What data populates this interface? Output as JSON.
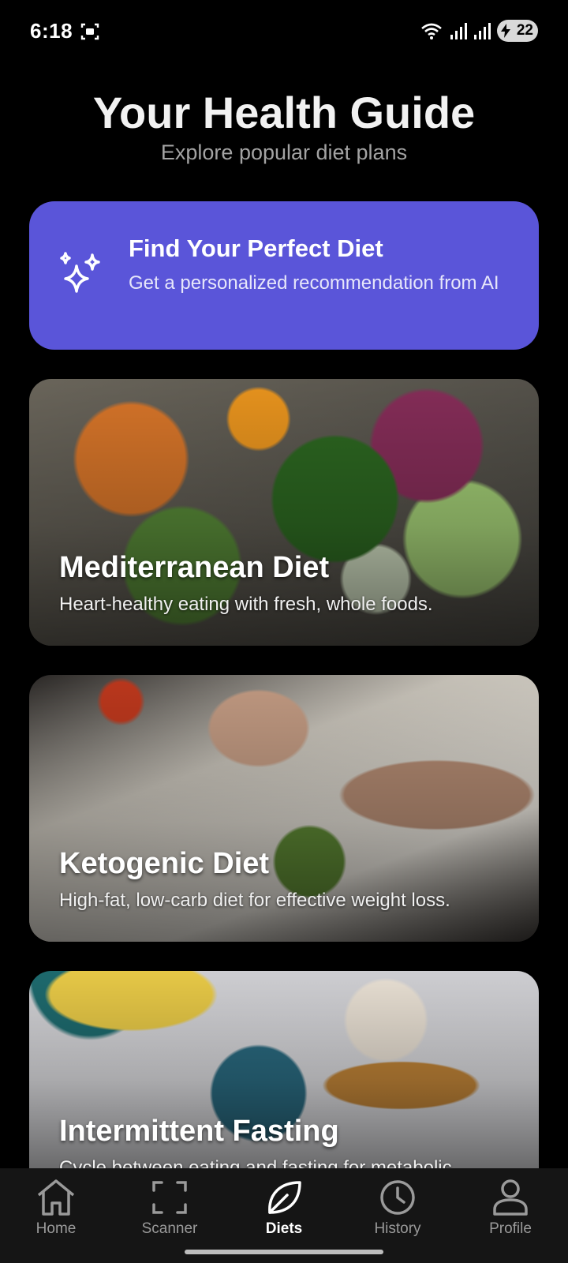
{
  "status_bar": {
    "time": "6:18",
    "battery": "22",
    "icons": [
      "screenshot-icon",
      "wifi-icon",
      "signal-icon",
      "signal-icon",
      "battery-icon"
    ]
  },
  "header": {
    "title": "Your Health Guide",
    "subtitle": "Explore popular diet plans"
  },
  "ai_card": {
    "title": "Find Your Perfect Diet",
    "description": "Get a personalized recommendation from AI",
    "icon": "sparkles-icon",
    "color": "#5a55d9"
  },
  "diets": [
    {
      "title": "Mediterranean Diet",
      "description": "Heart-healthy eating with fresh, whole foods."
    },
    {
      "title": "Ketogenic Diet",
      "description": "High-fat, low-carb diet for effective weight loss."
    },
    {
      "title": "Intermittent Fasting",
      "description": "Cycle between eating and fasting for metabolic"
    }
  ],
  "nav": {
    "items": [
      {
        "label": "Home",
        "icon": "home-icon"
      },
      {
        "label": "Scanner",
        "icon": "scan-frame-icon"
      },
      {
        "label": "Diets",
        "icon": "leaf-icon",
        "active": true
      },
      {
        "label": "History",
        "icon": "clock-icon"
      },
      {
        "label": "Profile",
        "icon": "user-icon"
      }
    ]
  }
}
